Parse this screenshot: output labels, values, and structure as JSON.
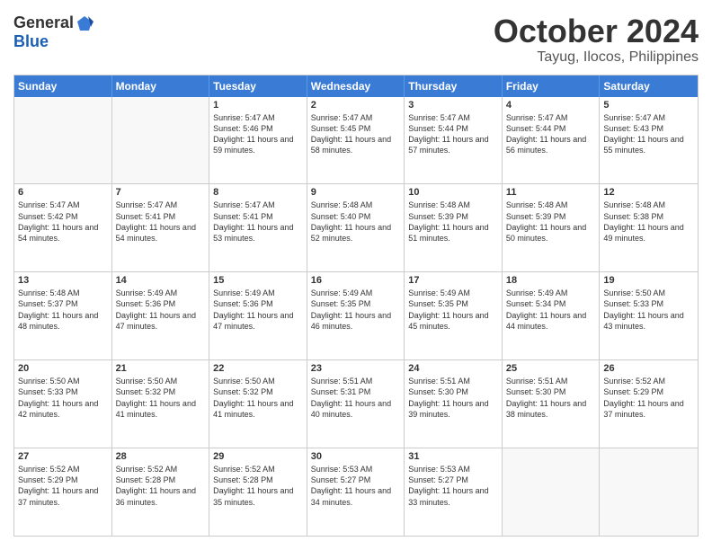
{
  "header": {
    "logo": {
      "general": "General",
      "blue": "Blue"
    },
    "title": "October 2024",
    "location": "Tayug, Ilocos, Philippines"
  },
  "days": [
    "Sunday",
    "Monday",
    "Tuesday",
    "Wednesday",
    "Thursday",
    "Friday",
    "Saturday"
  ],
  "weeks": [
    [
      {
        "day": "",
        "empty": true
      },
      {
        "day": "",
        "empty": true
      },
      {
        "day": "1",
        "sunrise": "Sunrise: 5:47 AM",
        "sunset": "Sunset: 5:46 PM",
        "daylight": "Daylight: 11 hours and 59 minutes."
      },
      {
        "day": "2",
        "sunrise": "Sunrise: 5:47 AM",
        "sunset": "Sunset: 5:45 PM",
        "daylight": "Daylight: 11 hours and 58 minutes."
      },
      {
        "day": "3",
        "sunrise": "Sunrise: 5:47 AM",
        "sunset": "Sunset: 5:44 PM",
        "daylight": "Daylight: 11 hours and 57 minutes."
      },
      {
        "day": "4",
        "sunrise": "Sunrise: 5:47 AM",
        "sunset": "Sunset: 5:44 PM",
        "daylight": "Daylight: 11 hours and 56 minutes."
      },
      {
        "day": "5",
        "sunrise": "Sunrise: 5:47 AM",
        "sunset": "Sunset: 5:43 PM",
        "daylight": "Daylight: 11 hours and 55 minutes."
      }
    ],
    [
      {
        "day": "6",
        "sunrise": "Sunrise: 5:47 AM",
        "sunset": "Sunset: 5:42 PM",
        "daylight": "Daylight: 11 hours and 54 minutes."
      },
      {
        "day": "7",
        "sunrise": "Sunrise: 5:47 AM",
        "sunset": "Sunset: 5:41 PM",
        "daylight": "Daylight: 11 hours and 54 minutes."
      },
      {
        "day": "8",
        "sunrise": "Sunrise: 5:47 AM",
        "sunset": "Sunset: 5:41 PM",
        "daylight": "Daylight: 11 hours and 53 minutes."
      },
      {
        "day": "9",
        "sunrise": "Sunrise: 5:48 AM",
        "sunset": "Sunset: 5:40 PM",
        "daylight": "Daylight: 11 hours and 52 minutes."
      },
      {
        "day": "10",
        "sunrise": "Sunrise: 5:48 AM",
        "sunset": "Sunset: 5:39 PM",
        "daylight": "Daylight: 11 hours and 51 minutes."
      },
      {
        "day": "11",
        "sunrise": "Sunrise: 5:48 AM",
        "sunset": "Sunset: 5:39 PM",
        "daylight": "Daylight: 11 hours and 50 minutes."
      },
      {
        "day": "12",
        "sunrise": "Sunrise: 5:48 AM",
        "sunset": "Sunset: 5:38 PM",
        "daylight": "Daylight: 11 hours and 49 minutes."
      }
    ],
    [
      {
        "day": "13",
        "sunrise": "Sunrise: 5:48 AM",
        "sunset": "Sunset: 5:37 PM",
        "daylight": "Daylight: 11 hours and 48 minutes."
      },
      {
        "day": "14",
        "sunrise": "Sunrise: 5:49 AM",
        "sunset": "Sunset: 5:36 PM",
        "daylight": "Daylight: 11 hours and 47 minutes."
      },
      {
        "day": "15",
        "sunrise": "Sunrise: 5:49 AM",
        "sunset": "Sunset: 5:36 PM",
        "daylight": "Daylight: 11 hours and 47 minutes."
      },
      {
        "day": "16",
        "sunrise": "Sunrise: 5:49 AM",
        "sunset": "Sunset: 5:35 PM",
        "daylight": "Daylight: 11 hours and 46 minutes."
      },
      {
        "day": "17",
        "sunrise": "Sunrise: 5:49 AM",
        "sunset": "Sunset: 5:35 PM",
        "daylight": "Daylight: 11 hours and 45 minutes."
      },
      {
        "day": "18",
        "sunrise": "Sunrise: 5:49 AM",
        "sunset": "Sunset: 5:34 PM",
        "daylight": "Daylight: 11 hours and 44 minutes."
      },
      {
        "day": "19",
        "sunrise": "Sunrise: 5:50 AM",
        "sunset": "Sunset: 5:33 PM",
        "daylight": "Daylight: 11 hours and 43 minutes."
      }
    ],
    [
      {
        "day": "20",
        "sunrise": "Sunrise: 5:50 AM",
        "sunset": "Sunset: 5:33 PM",
        "daylight": "Daylight: 11 hours and 42 minutes."
      },
      {
        "day": "21",
        "sunrise": "Sunrise: 5:50 AM",
        "sunset": "Sunset: 5:32 PM",
        "daylight": "Daylight: 11 hours and 41 minutes."
      },
      {
        "day": "22",
        "sunrise": "Sunrise: 5:50 AM",
        "sunset": "Sunset: 5:32 PM",
        "daylight": "Daylight: 11 hours and 41 minutes."
      },
      {
        "day": "23",
        "sunrise": "Sunrise: 5:51 AM",
        "sunset": "Sunset: 5:31 PM",
        "daylight": "Daylight: 11 hours and 40 minutes."
      },
      {
        "day": "24",
        "sunrise": "Sunrise: 5:51 AM",
        "sunset": "Sunset: 5:30 PM",
        "daylight": "Daylight: 11 hours and 39 minutes."
      },
      {
        "day": "25",
        "sunrise": "Sunrise: 5:51 AM",
        "sunset": "Sunset: 5:30 PM",
        "daylight": "Daylight: 11 hours and 38 minutes."
      },
      {
        "day": "26",
        "sunrise": "Sunrise: 5:52 AM",
        "sunset": "Sunset: 5:29 PM",
        "daylight": "Daylight: 11 hours and 37 minutes."
      }
    ],
    [
      {
        "day": "27",
        "sunrise": "Sunrise: 5:52 AM",
        "sunset": "Sunset: 5:29 PM",
        "daylight": "Daylight: 11 hours and 37 minutes."
      },
      {
        "day": "28",
        "sunrise": "Sunrise: 5:52 AM",
        "sunset": "Sunset: 5:28 PM",
        "daylight": "Daylight: 11 hours and 36 minutes."
      },
      {
        "day": "29",
        "sunrise": "Sunrise: 5:52 AM",
        "sunset": "Sunset: 5:28 PM",
        "daylight": "Daylight: 11 hours and 35 minutes."
      },
      {
        "day": "30",
        "sunrise": "Sunrise: 5:53 AM",
        "sunset": "Sunset: 5:27 PM",
        "daylight": "Daylight: 11 hours and 34 minutes."
      },
      {
        "day": "31",
        "sunrise": "Sunrise: 5:53 AM",
        "sunset": "Sunset: 5:27 PM",
        "daylight": "Daylight: 11 hours and 33 minutes."
      },
      {
        "day": "",
        "empty": true
      },
      {
        "day": "",
        "empty": true
      }
    ]
  ]
}
